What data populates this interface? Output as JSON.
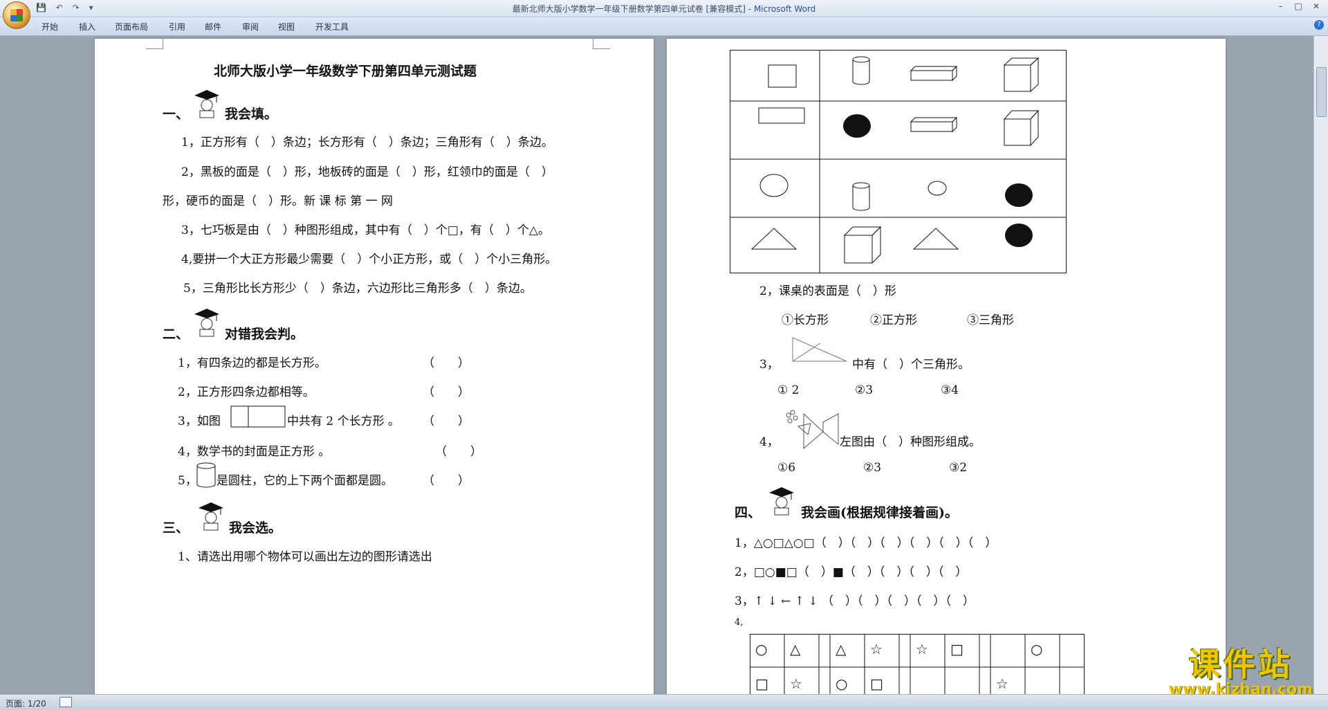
{
  "window": {
    "title": "最新北师大版小学数学一年级下册数学第四单元试卷 [兼容模式]",
    "app": "Microsoft Word",
    "separator": " - ",
    "controls": [
      "–",
      "□",
      "✕"
    ]
  },
  "ribbon_tabs": [
    "开始",
    "插入",
    "页面布局",
    "引用",
    "邮件",
    "审阅",
    "视图",
    "开发工具"
  ],
  "status": {
    "page": "页面: 1/20"
  },
  "watermark": {
    "brand": "课件站",
    "url": "www.kjzhan.com"
  },
  "left_page": {
    "title": "北师大版小学一年级数学下册第四单元测试题",
    "s1_num": "一、",
    "s1_title": "我会填。",
    "q1_1": "1，正方形有（　）条边；长方形有（　）条边；三角形有（　）条边。",
    "q1_2a": "2，黑板的面是（　）形，地板砖的面是（　）形，红领巾的面是（　）",
    "q1_2b": "形，硬币的面是（　）形。新 课 标 第 一 网",
    "q1_3": "3，七巧板是由（　）种图形组成，其中有（　）个□，有（　）个△。",
    "q1_4": "4,要拼一个大正方形最少需要（　）个小正方形，或（　）个小三角形。",
    "q1_5": "5，三角形比长方形少（　）条边，六边形比三角形多（　）条边。",
    "s2_num": "二、",
    "s2_title": "对错我会判。",
    "q2_1": "1，有四条边的都是长方形。",
    "q2_2": "2，正方形四条边都相等。",
    "q2_3a": "3，如图",
    "q2_3b": "中共有 2 个长方形 。",
    "q2_4": "4，数学书的封面是正方形 。",
    "q2_5a": "5，",
    "q2_5b": "是圆柱，它的上下两个面都是圆。",
    "paren": "（　　）",
    "s3_num": "三、",
    "s3_title": "我会选。",
    "q3_1": "1、请选出用哪个物体可以画出左边的图形请选出"
  },
  "right_page": {
    "q2": "2，课桌的表面是（　）形",
    "q2_opts": [
      "①长方形",
      "②正方形",
      "③三角形"
    ],
    "q3a": "3，",
    "q3b": "中有（　）个三角形。",
    "q3_opts": [
      "① 2",
      "②3",
      "③4"
    ],
    "q4a": "4，",
    "q4b": "左图由（　）种图形组成。",
    "q4_opts": [
      "①6",
      "②3",
      "③2"
    ],
    "s4_num": "四、",
    "s4_title": "我会画(根据规律接着画)。",
    "p1": "1，△○□△○□（　）（　）（　）（　）（　）（　）",
    "p2": "2，□○■□（　）■（　）（　）（　）（　）",
    "p3": "3，↑ ↓ ← ↑ ↓ （　）（　）（　）（　）（　）",
    "p4": "4,",
    "grid_row1": [
      "○",
      "△",
      "",
      "△",
      "☆",
      "",
      "☆",
      "□",
      "",
      "",
      "○"
    ],
    "grid_row2": [
      "□",
      "☆",
      "",
      "○",
      "□",
      "",
      "",
      "",
      "",
      "☆",
      ""
    ]
  }
}
